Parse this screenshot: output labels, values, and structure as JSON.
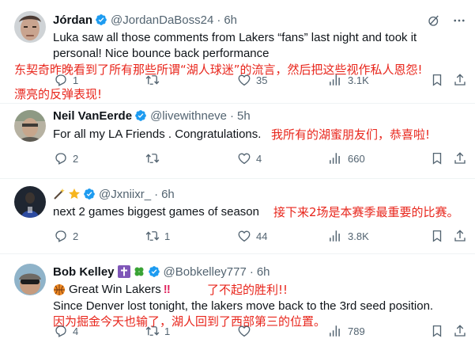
{
  "tweets": [
    {
      "name": "Jórdan",
      "handle": "@JordanDaBoss24",
      "time": "6h",
      "lines": [
        "Luka saw all those comments from Lakers “fans” last night and took it",
        "personal! Nice bounce back performance"
      ],
      "translation": [
        "东契奇昨晚看到了所有那些所谓“湖人球迷”的流言，然后把这些视作私人恩怨!",
        "漂亮的反弹表现!"
      ],
      "replies": "1",
      "retweets": "",
      "likes": "35",
      "views": "3.1K"
    },
    {
      "name": "Neil VanEerde",
      "handle": "@livewithneve",
      "time": "5h",
      "lines": [
        "For all my LA Friends . Congratulations."
      ],
      "translation": [
        "我所有的湖蜜朋友们，恭喜啦!"
      ],
      "replies": "2",
      "retweets": "",
      "likes": "4",
      "views": "660"
    },
    {
      "name": "",
      "handle": "@Jxniixr_",
      "time": "6h",
      "lines": [
        "next 2 games biggest games of season"
      ],
      "translation": [
        "接下来2场是本赛季最重要的比赛。"
      ],
      "replies": "2",
      "retweets": "1",
      "likes": "44",
      "views": "3.8K"
    },
    {
      "name": "Bob Kelley",
      "handle": "@Bobkelley777",
      "time": "6h",
      "lines": [
        "Great Win Lakers",
        "Since Denver lost tonight, the lakers move back to the 3rd seed position."
      ],
      "translation": [
        "了不起的胜利!!",
        "因为掘金今天也输了，湖人回到了西部第三的位置。"
      ],
      "replies": "4",
      "retweets": "1",
      "likes": "",
      "views": "789"
    }
  ],
  "icons": {
    "verified": "verified-badge-icon",
    "grok": "grok-icon",
    "more": "more-icon",
    "reply": "reply-icon",
    "retweet": "retweet-icon",
    "like": "like-icon",
    "views": "views-icon"
  },
  "colors": {
    "verified": "#1d9bf0",
    "annotation": "#e8261c",
    "muted": "#536471",
    "text": "#0f1419"
  }
}
